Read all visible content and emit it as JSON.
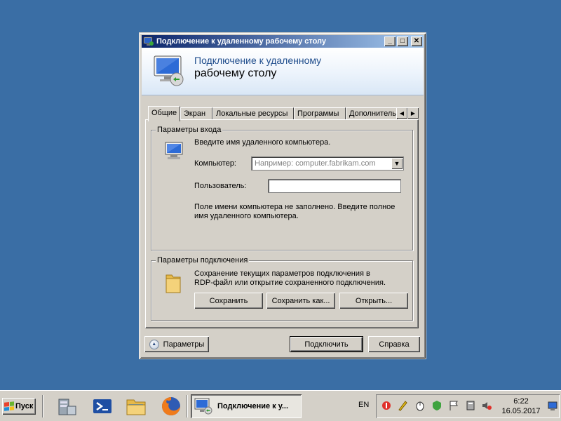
{
  "window": {
    "title": "Подключение к удаленному рабочему столу",
    "controls": {
      "minimize": "_",
      "maximize": "□",
      "close": "✕"
    },
    "banner_line1": "Подключение к удаленному",
    "banner_line2": "рабочему столу"
  },
  "tabs": [
    {
      "label": "Общие",
      "active": true
    },
    {
      "label": "Экран"
    },
    {
      "label": "Локальные ресурсы"
    },
    {
      "label": "Программы"
    },
    {
      "label": "Дополнительно"
    }
  ],
  "tab_scroll": {
    "left": "◀",
    "right": "▶"
  },
  "login_group": {
    "title": "Параметры входа",
    "instruction": "Введите имя удаленного компьютера.",
    "computer_label": "Компьютер:",
    "computer_placeholder": "Например: computer.fabrikam.com",
    "user_label": "Пользователь:",
    "user_value": "",
    "warning_line1": "Поле имени компьютера не заполнено. Введите полное",
    "warning_line2": "имя удаленного компьютера."
  },
  "connection_group": {
    "title": "Параметры подключения",
    "desc_line1": "Сохранение текущих параметров подключения в",
    "desc_line2": "RDP-файл или открытие сохраненного подключения.",
    "save": "Сохранить",
    "save_as": "Сохранить как...",
    "open": "Открыть..."
  },
  "footer": {
    "options": "Параметры",
    "connect": "Подключить",
    "help": "Справка"
  },
  "taskbar": {
    "start_label": "Пуск",
    "quick_launch": [
      "server-manager-icon",
      "powershell-icon",
      "explorer-icon",
      "firefox-icon"
    ],
    "task_label": "Подключение к у...",
    "lang": "EN",
    "time": "6:22",
    "date": "16.05.2017"
  },
  "colors": {
    "desktop": "#3a6ea5",
    "titlebar_start": "#0a246a",
    "titlebar_end": "#a6caf0",
    "face": "#d4d0c8",
    "banner_text": "#1f4d8c"
  }
}
